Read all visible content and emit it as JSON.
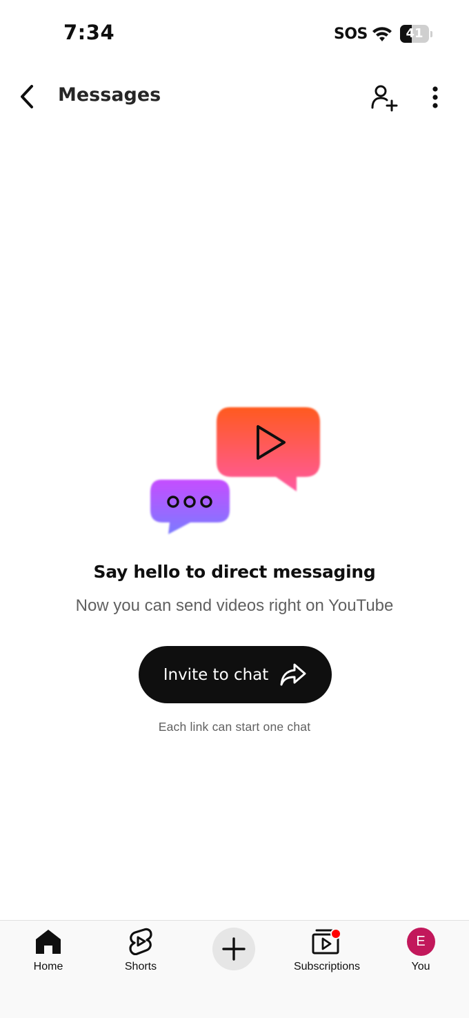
{
  "status_bar": {
    "time": "7:34",
    "carrier": "SOS",
    "battery_level": "41",
    "battery_fraction": 0.41
  },
  "header": {
    "title": "Messages",
    "back_icon": "chevron-left-icon",
    "add_person_icon": "person-add-icon",
    "more_icon": "more-vertical-icon"
  },
  "empty_state": {
    "title": "Say hello to direct messaging",
    "subtitle": "Now you can send videos right on YouTube",
    "button_label": "Invite to chat",
    "button_icon": "share-arrow-icon",
    "footnote": "Each link can start one chat",
    "colors": {
      "play_bubble_top": "#ff5a1f",
      "play_bubble_bottom": "#ff5aa0",
      "dots_bubble_top": "#c54dff",
      "dots_bubble_bottom": "#7b7bff"
    }
  },
  "bottom_nav": {
    "items": [
      {
        "label": "Home",
        "icon": "home-icon"
      },
      {
        "label": "Shorts",
        "icon": "shorts-icon"
      },
      {
        "label": "",
        "icon": "plus-icon"
      },
      {
        "label": "Subscriptions",
        "icon": "subscriptions-icon"
      },
      {
        "label": "You",
        "icon": "avatar",
        "avatar_letter": "E",
        "avatar_color": "#c2185b"
      }
    ],
    "notification_dot_color": "#ff0000"
  }
}
